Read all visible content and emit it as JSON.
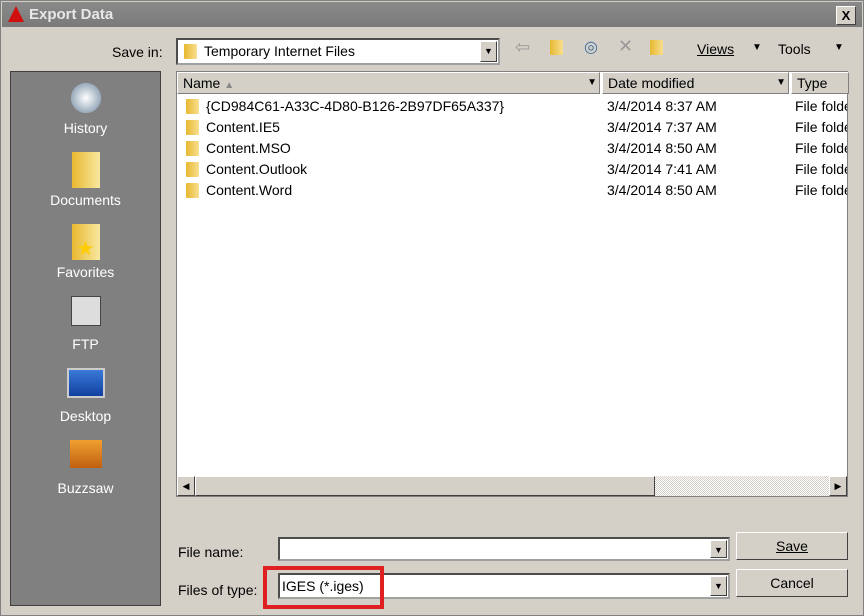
{
  "window": {
    "title": "Export Data",
    "close_label": "X"
  },
  "toolbar": {
    "save_in_label": "Save in:",
    "save_in_value": "Temporary Internet Files",
    "views_label": "Views",
    "tools_label": "Tools"
  },
  "places": [
    {
      "label": "History",
      "icon": "history-icon"
    },
    {
      "label": "Documents",
      "icon": "documents-icon"
    },
    {
      "label": "Favorites",
      "icon": "favorites-icon"
    },
    {
      "label": "FTP",
      "icon": "ftp-icon"
    },
    {
      "label": "Desktop",
      "icon": "desktop-icon"
    },
    {
      "label": "Buzzsaw",
      "icon": "buzzsaw-icon"
    }
  ],
  "columns": {
    "name": "Name",
    "date": "Date modified",
    "type": "Type"
  },
  "files": [
    {
      "name": "{CD984C61-A33C-4D80-B126-2B97DF65A337}",
      "date": "3/4/2014 8:37 AM",
      "type": "File folder"
    },
    {
      "name": "Content.IE5",
      "date": "3/4/2014 7:37 AM",
      "type": "File folder"
    },
    {
      "name": "Content.MSO",
      "date": "3/4/2014 8:50 AM",
      "type": "File folder"
    },
    {
      "name": "Content.Outlook",
      "date": "3/4/2014 7:41 AM",
      "type": "File folder"
    },
    {
      "name": "Content.Word",
      "date": "3/4/2014 8:50 AM",
      "type": "File folder"
    }
  ],
  "form": {
    "file_name_label": "File name:",
    "file_name_value": "",
    "file_type_label": "Files of type:",
    "file_type_value": "IGES (*.iges)",
    "save_label": "Save",
    "cancel_label": "Cancel"
  },
  "colors": {
    "highlight": "#e02020",
    "titlebar": "#7f7f7f"
  }
}
